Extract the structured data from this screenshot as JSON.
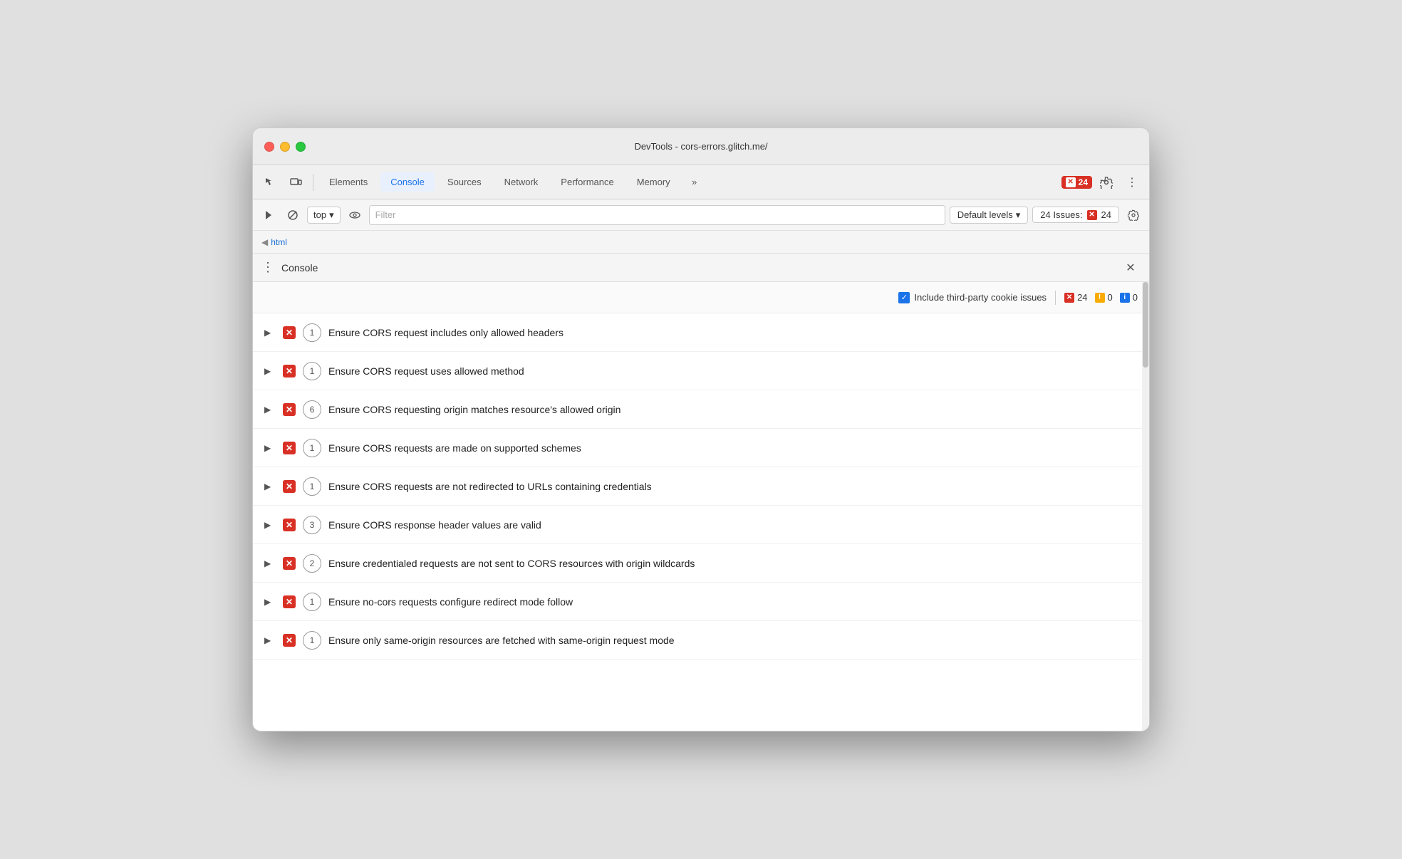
{
  "window": {
    "title": "DevTools - cors-errors.glitch.me/"
  },
  "toolbar": {
    "tabs": [
      {
        "id": "elements",
        "label": "Elements",
        "active": false
      },
      {
        "id": "console",
        "label": "Console",
        "active": true
      },
      {
        "id": "sources",
        "label": "Sources",
        "active": false
      },
      {
        "id": "network",
        "label": "Network",
        "active": false
      },
      {
        "id": "performance",
        "label": "Performance",
        "active": false
      },
      {
        "id": "memory",
        "label": "Memory",
        "active": false
      }
    ],
    "more_label": "»",
    "error_count": "24",
    "settings_label": "⚙",
    "more_menu_label": "⋮"
  },
  "console_toolbar": {
    "play_label": "▶",
    "block_label": "🚫",
    "top_label": "top",
    "dropdown_arrow": "▾",
    "eye_label": "👁",
    "filter_placeholder": "Filter",
    "levels_label": "Default levels",
    "levels_arrow": "▾",
    "issues_label": "24 Issues:",
    "issues_count": "24",
    "settings_label": "⚙"
  },
  "breadcrumb": {
    "arrow": "◀",
    "text": "html"
  },
  "console_panel": {
    "menu_icon": "⋮",
    "title": "Console",
    "close_label": "✕"
  },
  "issues_toolbar": {
    "checkbox_label": "Include third-party cookie issues",
    "error_count": "24",
    "warn_count": "0",
    "info_count": "0"
  },
  "issues": [
    {
      "count": 1,
      "text": "Ensure CORS request includes only allowed headers"
    },
    {
      "count": 1,
      "text": "Ensure CORS request uses allowed method"
    },
    {
      "count": 6,
      "text": "Ensure CORS requesting origin matches resource's allowed origin"
    },
    {
      "count": 1,
      "text": "Ensure CORS requests are made on supported schemes"
    },
    {
      "count": 1,
      "text": "Ensure CORS requests are not redirected to URLs containing credentials"
    },
    {
      "count": 3,
      "text": "Ensure CORS response header values are valid"
    },
    {
      "count": 2,
      "text": "Ensure credentialed requests are not sent to CORS resources with origin wildcards"
    },
    {
      "count": 1,
      "text": "Ensure no-cors requests configure redirect mode follow"
    },
    {
      "count": 1,
      "text": "Ensure only same-origin resources are fetched with same-origin request mode"
    }
  ]
}
